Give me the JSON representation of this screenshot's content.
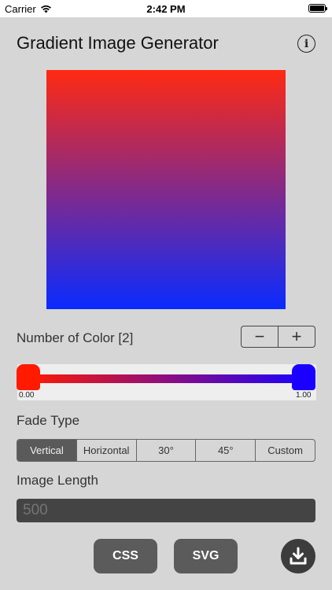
{
  "status_bar": {
    "carrier": "Carrier",
    "time": "2:42 PM"
  },
  "header": {
    "title": "Gradient Image Generator",
    "info_icon": "info-icon",
    "info_glyph": "i"
  },
  "preview": {
    "start_color": "#ff2a12",
    "end_color": "#0a2bff",
    "direction": "vertical"
  },
  "color_count": {
    "label": "Number of Color [2]",
    "minus_label": "−",
    "plus_label": "+"
  },
  "color_slider": {
    "stops": [
      {
        "position_label": "0.00",
        "position": 0.0,
        "color": "#ff1a00"
      },
      {
        "position_label": "1.00",
        "position": 1.0,
        "color": "#1a00ff"
      }
    ]
  },
  "fade_type": {
    "label": "Fade Type",
    "options": [
      "Vertical",
      "Horizontal",
      "30°",
      "45°",
      "Custom"
    ],
    "selected": "Vertical"
  },
  "image_length": {
    "label": "Image Length",
    "value": "500"
  },
  "buttons": {
    "css": "CSS",
    "svg": "SVG",
    "download_icon": "download-icon"
  },
  "colors": {
    "background": "#d6d6d6",
    "dark_button": "#5b5b5b",
    "selected_segment": "#5a5a5a"
  }
}
